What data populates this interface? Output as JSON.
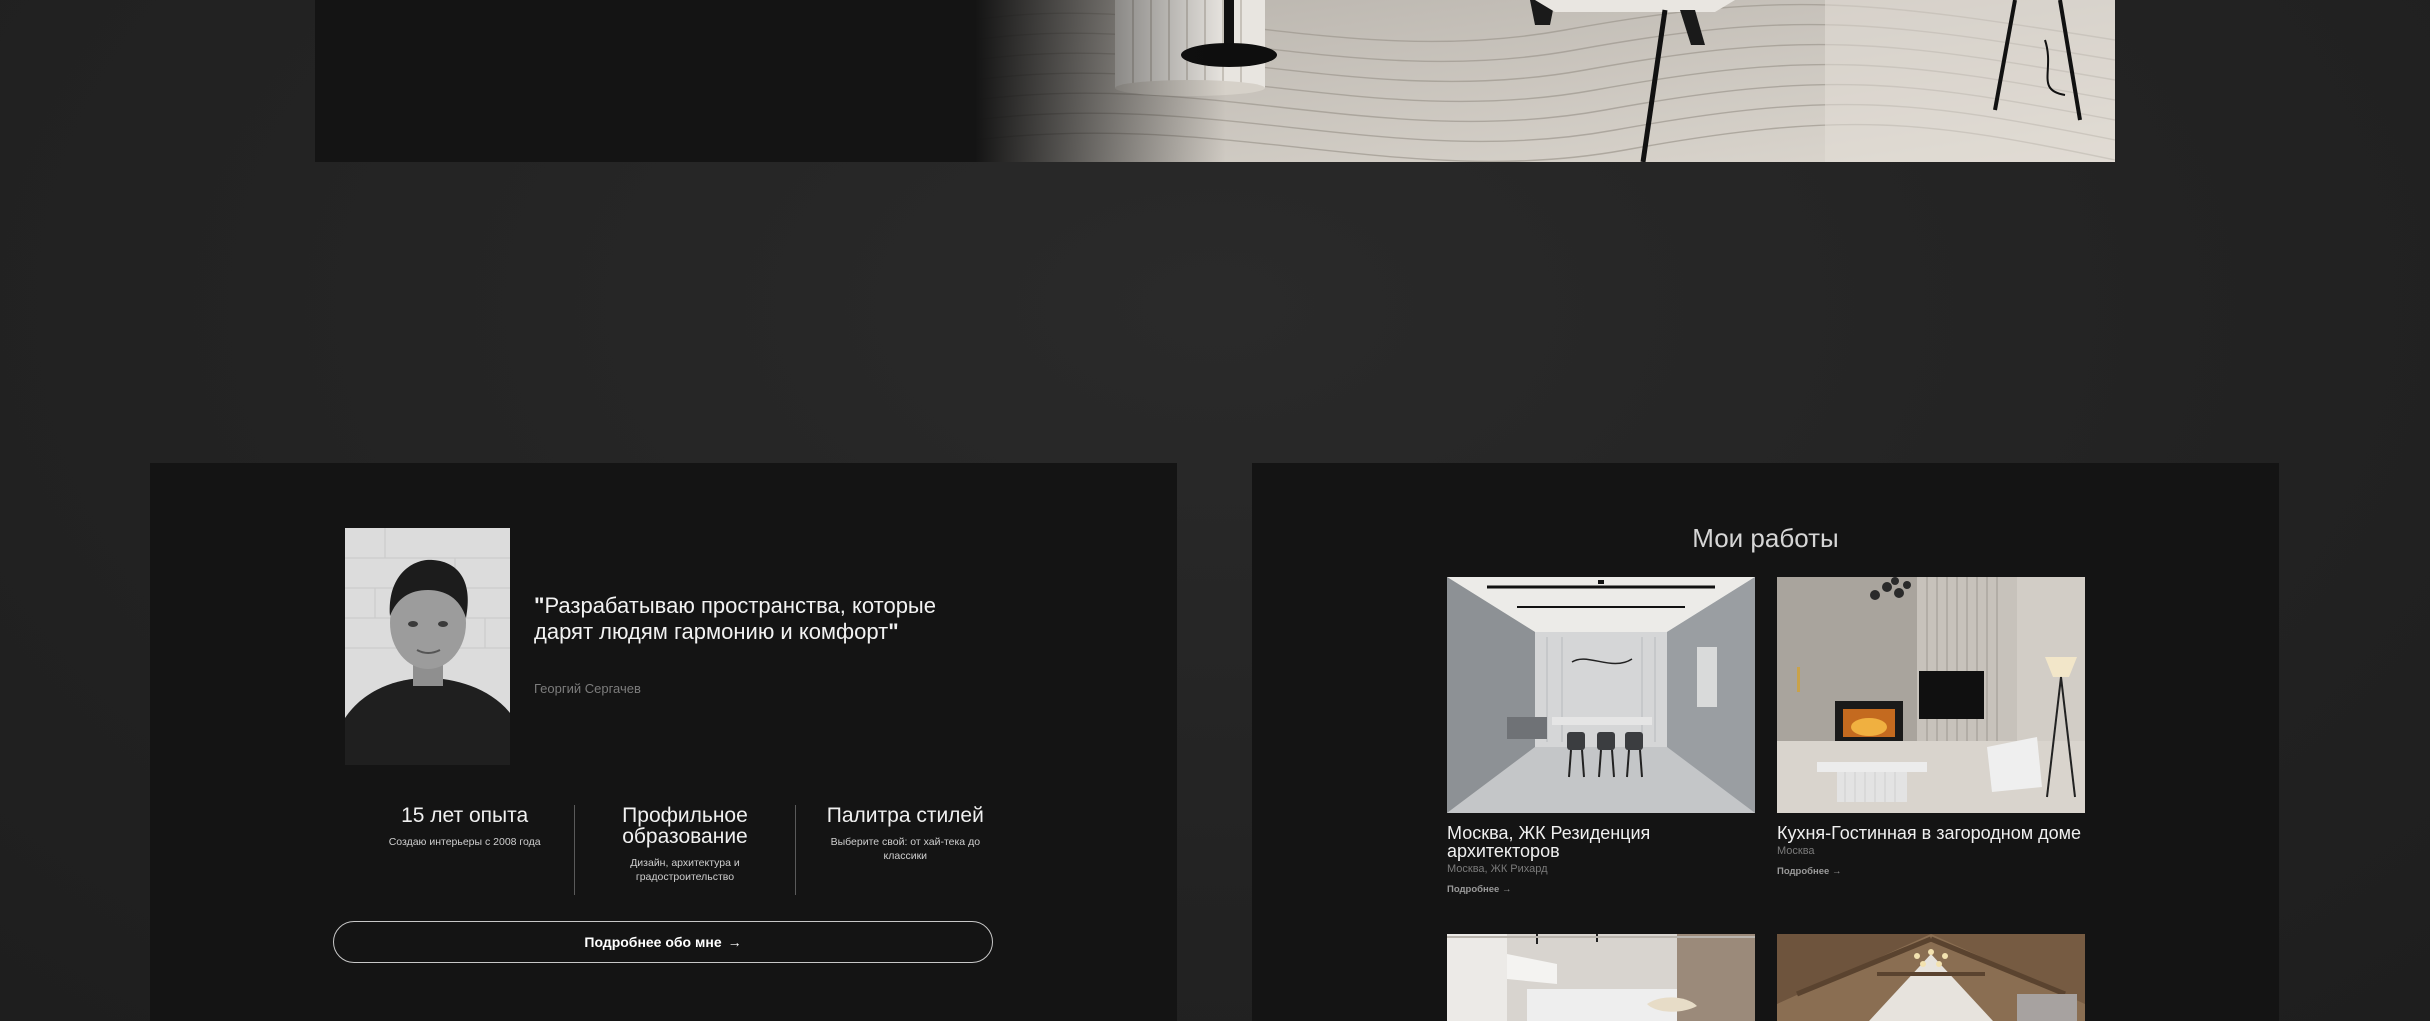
{
  "about": {
    "quote_open": "\"",
    "quote_text": "Разрабатываю пространства, которые дарят людям гармонию и комфорт",
    "quote_close": "\"",
    "author": "Георгий Сергачев",
    "stats": [
      {
        "title": "15 лет опыта",
        "desc": "Создаю интерьеры с 2008 года"
      },
      {
        "title": "Профильное образование",
        "desc": "Дизайн, архитектура и градостроительство"
      },
      {
        "title": "Палитра стилей",
        "desc": "Выберите свой: от хай-тека до классики"
      }
    ],
    "more_label": "Подробнее обо мне",
    "more_arrow": "→"
  },
  "works": {
    "title": "Мои работы",
    "items": [
      {
        "title": "Москва, ЖК Резиденция архитекторов",
        "subtitle": "Москва, ЖК Рихард",
        "more": "Подробнее →"
      },
      {
        "title": "Кухня-Гостинная в загородном доме",
        "subtitle": "Москва",
        "more": "Подробнее →"
      }
    ]
  }
}
